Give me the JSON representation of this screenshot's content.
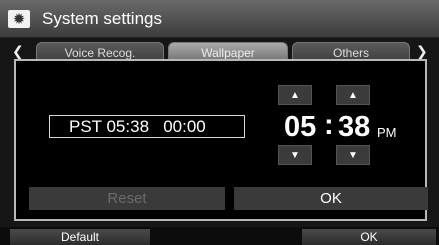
{
  "header": {
    "title": "System settings",
    "icon": "gear-icon"
  },
  "tabs": [
    {
      "label": "Voice Recog."
    },
    {
      "label": "Wallpaper"
    },
    {
      "label": "Others"
    }
  ],
  "dialog": {
    "clock_display": "PST 05:38   00:00",
    "hour": "05",
    "separator": ":",
    "minute": "38",
    "ampm": "PM",
    "up_symbol": "▲",
    "down_symbol": "▼",
    "reset_label": "Reset",
    "ok_label": "OK"
  },
  "footer": {
    "default_label": "Default",
    "ok_label": "OK"
  },
  "tab_arrows": {
    "left": "❮",
    "right": "❯"
  }
}
